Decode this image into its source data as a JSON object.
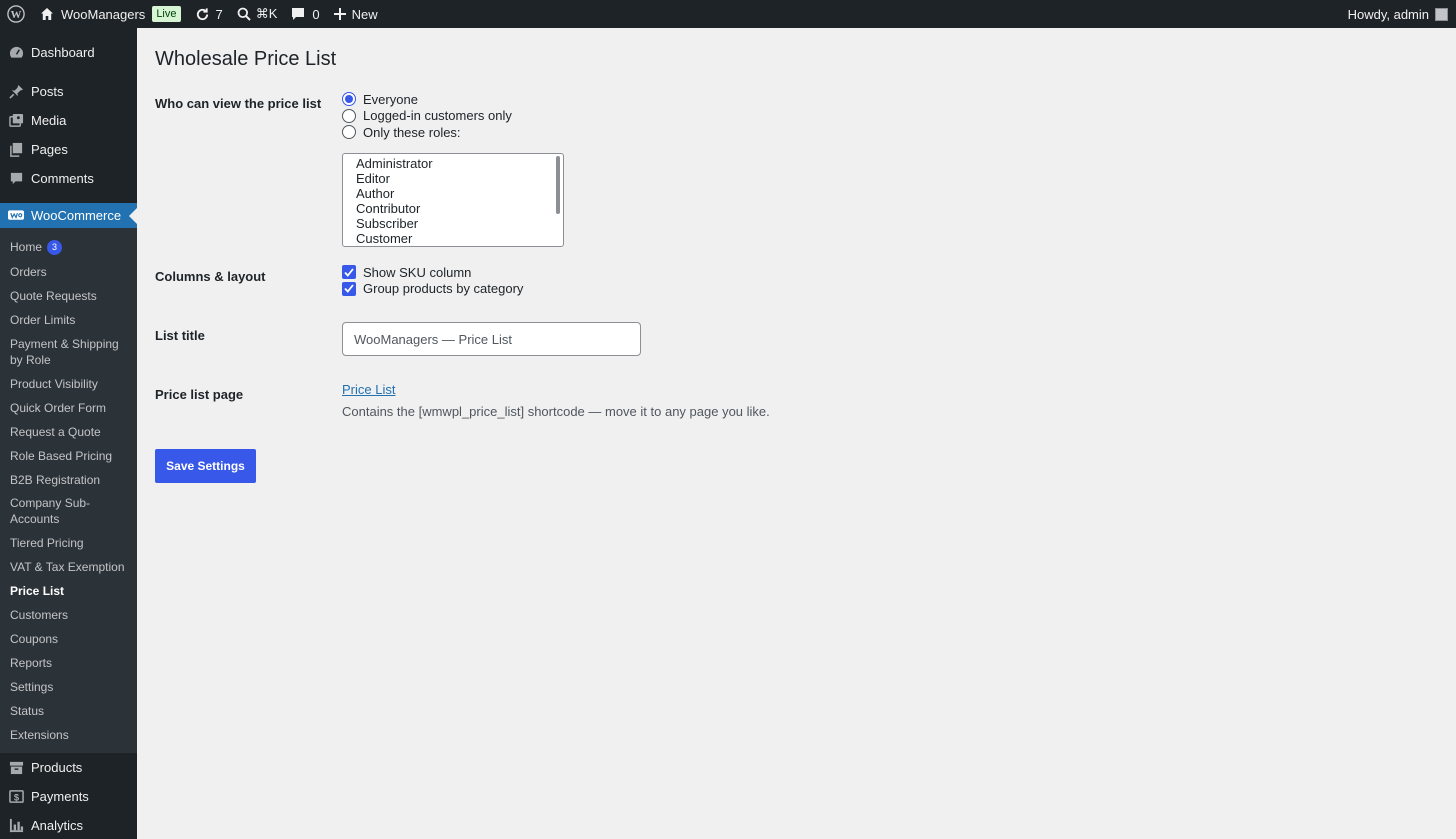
{
  "adminbar": {
    "site_name": "WooManagers",
    "live_label": "Live",
    "updates_count": "7",
    "search_shortcut": "⌘K",
    "comments_count": "0",
    "new_label": "New",
    "howdy": "Howdy, admin"
  },
  "sidebar": {
    "top_items": [
      {
        "label": "Dashboard",
        "icon": "dashboard-icon"
      },
      {
        "label": "Posts",
        "icon": "pin-icon"
      },
      {
        "label": "Media",
        "icon": "media-icon"
      },
      {
        "label": "Pages",
        "icon": "pages-icon"
      },
      {
        "label": "Comments",
        "icon": "comment-icon"
      }
    ],
    "woocommerce_label": "WooCommerce",
    "submenu": [
      {
        "label": "Home",
        "badge": "3"
      },
      {
        "label": "Orders"
      },
      {
        "label": "Quote Requests"
      },
      {
        "label": "Order Limits"
      },
      {
        "label": "Payment & Shipping by Role"
      },
      {
        "label": "Product Visibility"
      },
      {
        "label": "Quick Order Form"
      },
      {
        "label": "Request a Quote"
      },
      {
        "label": "Role Based Pricing"
      },
      {
        "label": "B2B Registration"
      },
      {
        "label": "Company Sub-Accounts"
      },
      {
        "label": "Tiered Pricing"
      },
      {
        "label": "VAT & Tax Exemption"
      },
      {
        "label": "Price List"
      },
      {
        "label": "Customers"
      },
      {
        "label": "Coupons"
      },
      {
        "label": "Reports"
      },
      {
        "label": "Settings"
      },
      {
        "label": "Status"
      },
      {
        "label": "Extensions"
      }
    ],
    "bottom_items": [
      {
        "label": "Products",
        "icon": "archive-icon"
      },
      {
        "label": "Payments",
        "icon": "dollar-icon"
      },
      {
        "label": "Analytics",
        "icon": "bar-chart-icon"
      }
    ]
  },
  "page": {
    "title": "Wholesale Price List",
    "visibility": {
      "label": "Who can view the price list",
      "options": [
        "Everyone",
        "Logged-in customers only",
        "Only these roles:"
      ],
      "selected": "Everyone",
      "roles": [
        "Administrator",
        "Editor",
        "Author",
        "Contributor",
        "Subscriber",
        "Customer"
      ]
    },
    "columns": {
      "label": "Columns & layout",
      "show_sku": "Show SKU column",
      "group_by_category": "Group products by category",
      "show_sku_checked": true,
      "group_by_category_checked": true
    },
    "list_title": {
      "label": "List title",
      "value": "WooManagers — Price List"
    },
    "price_list_page": {
      "label": "Price list page",
      "link_text": "Price List",
      "description": "Contains the [wmwpl_price_list] shortcode — move it to any page you like."
    },
    "save_label": "Save Settings"
  },
  "colors": {
    "accent": "#3858e9",
    "admin_bar": "#1d2327",
    "menu_current": "#2271b1",
    "live_badge_bg": "#d7f4d3"
  }
}
